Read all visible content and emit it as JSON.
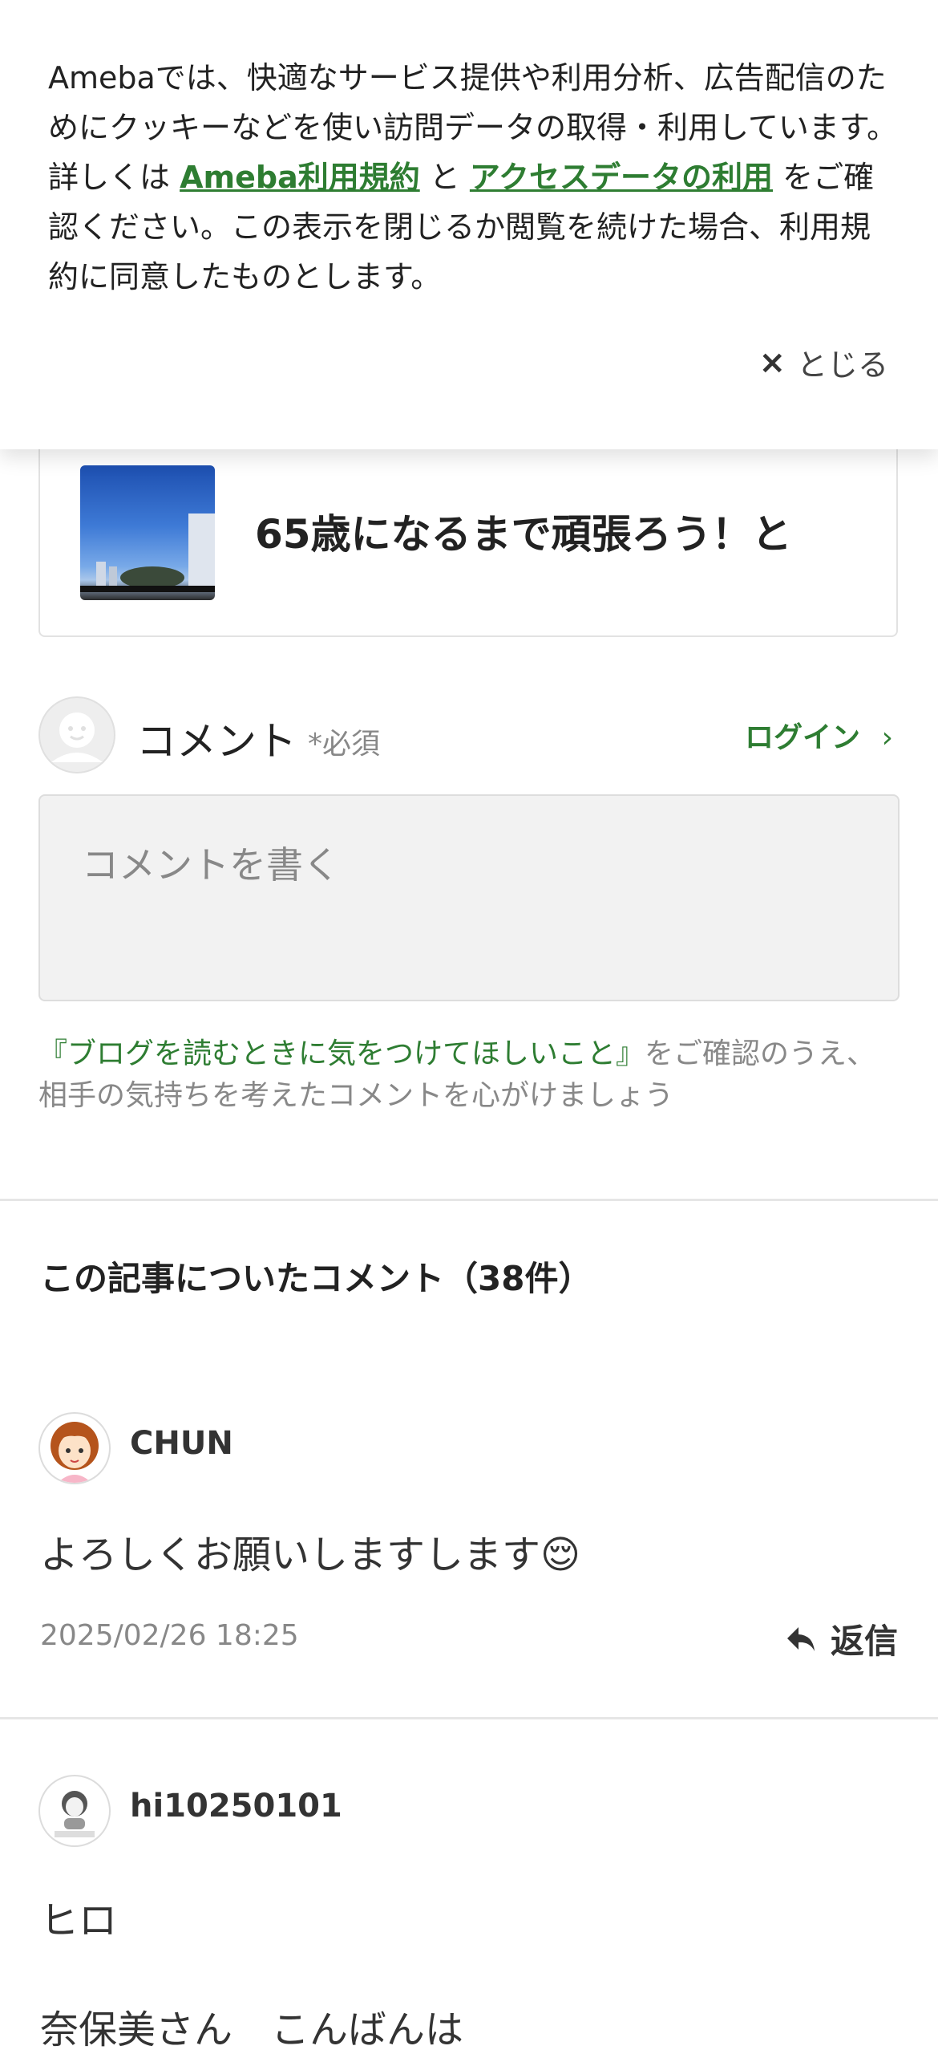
{
  "cookie_banner": {
    "text_before": "Amebaでは、快適なサービス提供や利用分析、広告配信のためにクッキーなどを使い訪問データの取得・利用しています。詳しくは ",
    "link_terms": "Ameba利用規約",
    "text_and": " と ",
    "link_access": "アクセスデータの利用",
    "text_after": " をご確認ください。この表示を閉じるか閲覧を続けた場合、利用規約に同意したものとします。",
    "close_icon": "×",
    "close_label": "とじる"
  },
  "article_card": {
    "title": "65歳になるまで頑張ろう！と"
  },
  "comment_form": {
    "label": "コメント",
    "required": "*必須",
    "login": "ログイン",
    "login_chevron": "›",
    "placeholder": "コメントを書く",
    "guide_link": "『ブログを読むときに気をつけてほしいこと』",
    "guide_rest": "をご確認のうえ、相手の気持ちを考えたコメントを心がけましょう"
  },
  "comments_section": {
    "title": "この記事についたコメント（38件）",
    "comments": [
      {
        "author": "CHUN",
        "body": "よろしくお願いしますします😌",
        "date": "2025/02/26 18:25",
        "reply_label": "返信",
        "avatar_icon": "girl-avatar-icon"
      },
      {
        "author": "hi10250101",
        "body": "ヒロ",
        "body2": "奈保美さん　こんばんは",
        "avatar_icon": "no-image-avatar-icon"
      }
    ]
  },
  "colors": {
    "accent_green": "#2e7d32",
    "text_gray": "#888888",
    "divider": "#e6e6e6"
  }
}
